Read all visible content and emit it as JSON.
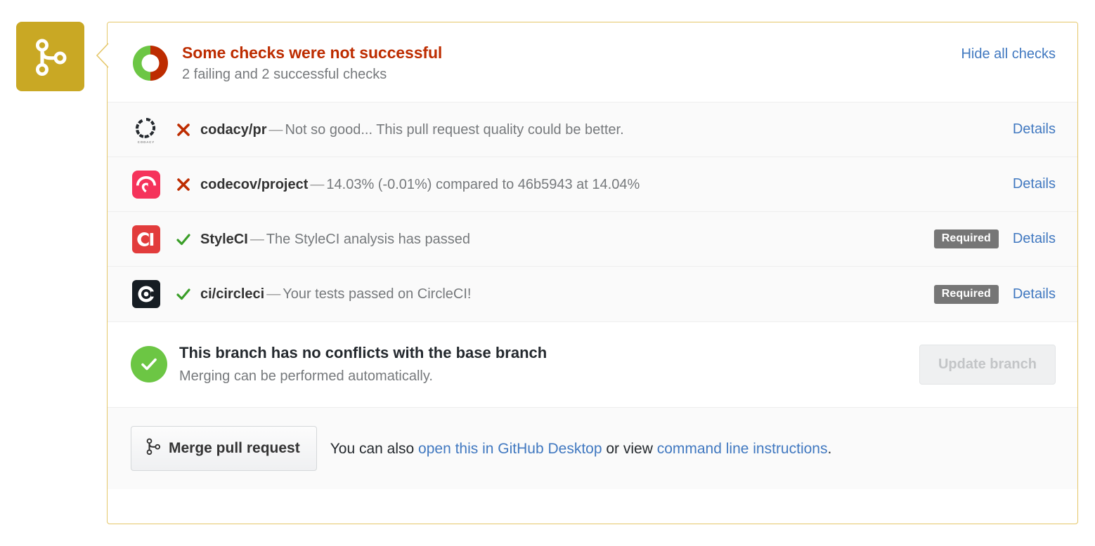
{
  "status_badge": {
    "icon": "git-merge-icon",
    "color": "#c9a824"
  },
  "checks_header": {
    "title": "Some checks were not successful",
    "subtitle": "2 failing and 2 successful checks",
    "hide_all_label": "Hide all checks",
    "donut": {
      "success_color": "#6cc644",
      "failure_color": "#bd2c00",
      "success_fraction": 0.5,
      "failure_fraction": 0.5
    },
    "title_color": "#bd2c00",
    "link_color": "#4078c0"
  },
  "checks": [
    {
      "vendor_icon": "codacy-icon",
      "vendor_label": "CODACY",
      "state": "failure",
      "state_icon": "x-icon",
      "context": "codacy/pr",
      "dash": "—",
      "description": "Not so good... This pull request quality could be better.",
      "required": null,
      "details_label": "Details"
    },
    {
      "vendor_icon": "codecov-icon",
      "vendor_label": "",
      "state": "failure",
      "state_icon": "x-icon",
      "context": "codecov/project",
      "dash": "—",
      "description": "14.03% (-0.01%) compared to 46b5943 at 14.04%",
      "required": null,
      "details_label": "Details"
    },
    {
      "vendor_icon": "styleci-icon",
      "vendor_label": "CI",
      "state": "success",
      "state_icon": "check-icon",
      "context": "StyleCI",
      "dash": "—",
      "description": "The StyleCI analysis has passed",
      "required": "Required",
      "details_label": "Details"
    },
    {
      "vendor_icon": "circleci-icon",
      "vendor_label": "",
      "state": "success",
      "state_icon": "check-icon",
      "context": "ci/circleci",
      "dash": "—",
      "description": "Your tests passed on CircleCI!",
      "required": "Required",
      "details_label": "Details"
    }
  ],
  "conflict_section": {
    "icon": "check-circle-icon",
    "icon_color": "#6cc644",
    "title": "This branch has no conflicts with the base branch",
    "subtitle": "Merging can be performed automatically.",
    "update_branch_label": "Update branch"
  },
  "footer": {
    "merge_button_label": "Merge pull request",
    "merge_button_icon": "git-merge-icon",
    "text_prefix": "You can also ",
    "desktop_link": "open this in GitHub Desktop",
    "text_middle": " or view ",
    "cli_link": "command line instructions",
    "text_suffix": "."
  }
}
